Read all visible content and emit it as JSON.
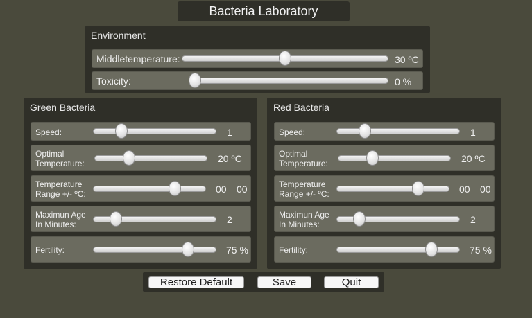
{
  "title": "Bacteria Laboratory",
  "environment": {
    "title": "Environment",
    "middle_temperature": {
      "label": "Middletemperature:",
      "value": "30 ºC",
      "level": 0.5
    },
    "toxicity": {
      "label": "Toxicity:",
      "value": "0 %",
      "level": 0.0
    }
  },
  "green": {
    "title": "Green Bacteria",
    "speed": {
      "label": "Speed:",
      "value": "1",
      "level": 0.2
    },
    "optimal_temp": {
      "label_1": "Optimal",
      "label_2": "Temperature:",
      "value": "20 ºC",
      "level": 0.28
    },
    "temp_range": {
      "label_1": "Temperature",
      "label_2": "Range +/-  ºC:",
      "value_a": "00",
      "value_b": "00",
      "level": 0.75
    },
    "max_age": {
      "label_1": "Maximun Age",
      "label_2": "In Minutes:",
      "value": "2",
      "level": 0.15
    },
    "fertility": {
      "label": "Fertility:",
      "value": "75 %",
      "level": 0.8
    }
  },
  "red": {
    "title": "Red Bacteria",
    "speed": {
      "label": "Speed:",
      "value": "1",
      "level": 0.2
    },
    "optimal_temp": {
      "label_1": "Optimal",
      "label_2": "Temperature:",
      "value": "20 ºC",
      "level": 0.28
    },
    "temp_range": {
      "label_1": "Temperature",
      "label_2": "Range +/-  ºC:",
      "value_a": "00",
      "value_b": "00",
      "level": 0.75
    },
    "max_age": {
      "label_1": "Maximun Age",
      "label_2": "In Minutes:",
      "value": "2",
      "level": 0.15
    },
    "fertility": {
      "label": "Fertility:",
      "value": "75 %",
      "level": 0.8
    }
  },
  "buttons": {
    "restore": "Restore Default",
    "save": "Save",
    "quit": "Quit"
  }
}
